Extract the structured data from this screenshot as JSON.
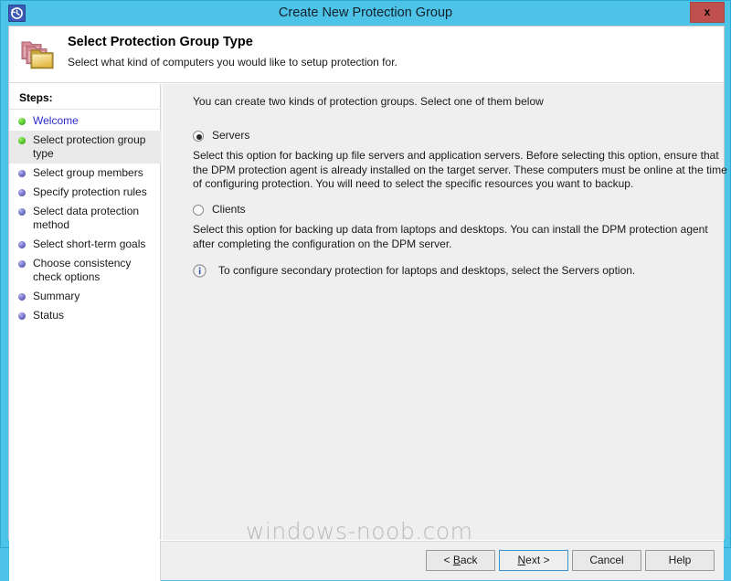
{
  "window": {
    "title": "Create New Protection Group",
    "app_icon": "history-clock-icon",
    "close_label": "x",
    "frame_color": "#4ec3e8"
  },
  "header": {
    "icon": "protection-group-folders-icon",
    "title": "Select Protection Group Type",
    "subtitle": "Select what kind of computers you would like to setup protection for."
  },
  "sidebar": {
    "heading": "Steps:",
    "items": [
      {
        "label": "Welcome",
        "state": "done",
        "link": true
      },
      {
        "label": "Select protection group type",
        "state": "done",
        "active": true
      },
      {
        "label": "Select group members",
        "state": "todo"
      },
      {
        "label": "Specify protection rules",
        "state": "todo"
      },
      {
        "label": "Select data protection method",
        "state": "todo"
      },
      {
        "label": "Select short-term goals",
        "state": "todo"
      },
      {
        "label": "Choose consistency check options",
        "state": "todo"
      },
      {
        "label": "Summary",
        "state": "todo"
      },
      {
        "label": "Status",
        "state": "todo"
      }
    ]
  },
  "main": {
    "intro": "You can create two kinds of protection groups. Select one of them below",
    "options": [
      {
        "label": "Servers",
        "selected": true,
        "description": "Select this option for backing up file servers and application servers. Before selecting this option, ensure that the DPM protection agent is already installed on the target server. These computers must be online at the time of configuring protection. You will need to select the specific resources you want to backup."
      },
      {
        "label": "Clients",
        "selected": false,
        "description": "Select this option for backing up data from laptops and desktops. You can install the DPM protection agent after completing the configuration on the DPM server."
      }
    ],
    "note": {
      "icon": "info-icon",
      "text": "To configure secondary protection for laptops and desktops, select the Servers option."
    }
  },
  "footer": {
    "buttons": [
      {
        "id": "back",
        "label": "< Back",
        "accel": "B",
        "default": false
      },
      {
        "id": "next",
        "label": "Next >",
        "accel": "N",
        "default": true
      },
      {
        "id": "cancel",
        "label": "Cancel",
        "accel": "",
        "default": false
      },
      {
        "id": "help",
        "label": "Help",
        "accel": "",
        "default": false
      }
    ]
  },
  "watermark": "windows-noob.com"
}
